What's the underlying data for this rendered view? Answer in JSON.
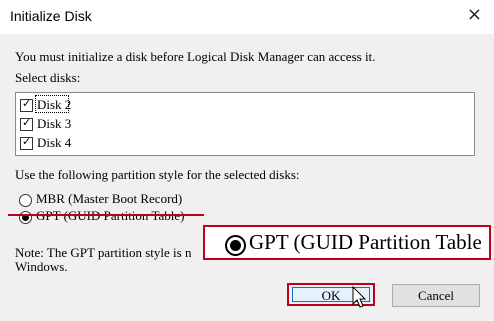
{
  "dialog": {
    "title": "Initialize Disk",
    "close_glyph": "×",
    "intro": "You must initialize a disk before Logical Disk Manager can access it.",
    "select_label": "Select disks:",
    "disks": [
      {
        "label": "Disk 2",
        "checked": true
      },
      {
        "label": "Disk 3",
        "checked": true
      },
      {
        "label": "Disk 4",
        "checked": true
      }
    ],
    "check_glyph": "✓",
    "partition_label": "Use the following partition style for the selected disks:",
    "options": {
      "mbr": "MBR (Master Boot Record)",
      "gpt": "GPT (GUID Partition Table)",
      "selected": "gpt"
    },
    "note_line1": "Note: The GPT partition style is n",
    "note_line2": "Windows.",
    "ok_label": "OK",
    "cancel_label": "Cancel"
  },
  "callout": {
    "text": "GPT (GUID Partition Table",
    "border_color": "#c0001a"
  },
  "icons": {
    "close": "close-icon",
    "cursor": "mouse-pointer-icon"
  }
}
